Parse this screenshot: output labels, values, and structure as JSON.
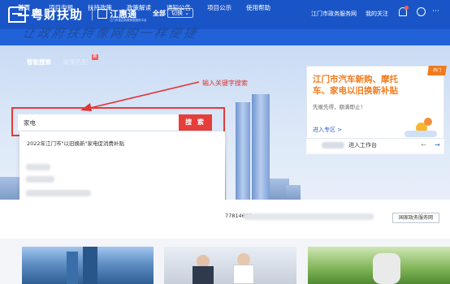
{
  "header": {
    "brand_primary": "粤财扶助",
    "brand_secondary": "江惠通",
    "brand_secondary_sub": "江门市惠企政策精准服务平台",
    "region_label": "全部",
    "switch_label": "切换",
    "links": [
      "江门市政务服务网",
      "我的关注"
    ],
    "icons": [
      "bell-icon",
      "user-icon",
      "more-icon"
    ],
    "colors": {
      "bar": "#1a55c7",
      "nav": "#2262d8"
    }
  },
  "nav": {
    "items": [
      "首页",
      "项目申报",
      "扶持政策",
      "政策解读",
      "通知公告",
      "项目公示",
      "使用帮助"
    ],
    "active_index": 0
  },
  "hero": {
    "slogan": "让政府扶持像网购一样便捷",
    "tabs": [
      "智能搜索",
      "政策匹配"
    ],
    "tab_badge": "新",
    "annotation": "输入关键字搜索",
    "search": {
      "value": "家电",
      "button_label": "搜 索"
    },
    "dropdown": {
      "first_suggestion": "2022年江门市\"以旧换新\"家电促消费补贴",
      "blurred_count": 6
    }
  },
  "promo_card": {
    "corner": "热门",
    "title": "江门市汽车新购、摩托车、家电以旧换新补贴",
    "subtitle": "先报先得，额满即止！",
    "link": "进入专区 >",
    "workbench": "进入工作台",
    "prev_icon": "arrow-left-icon",
    "next_icon": "arrow-right-icon",
    "accent": "#f07b1c"
  },
  "info_strip": {
    "phone_fragment": "77814686",
    "gov_button": "国家政务服务网"
  }
}
